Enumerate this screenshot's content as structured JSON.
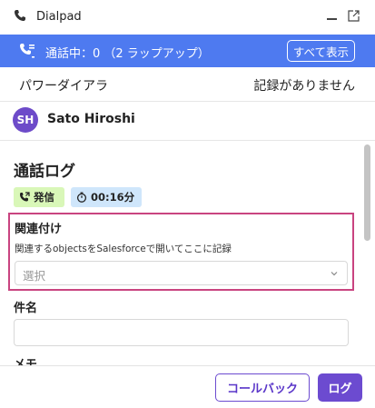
{
  "window": {
    "title": "Dialpad",
    "phone_icon": "phone-icon",
    "minimize_icon": "minimize-icon",
    "popout_icon": "popout-icon"
  },
  "banner": {
    "status_text": "通話中：0 （2 ラップアップ）",
    "show_all_label": "すべて表示",
    "icon": "call-queue-icon",
    "color": "#4e7af0"
  },
  "power_dialer": {
    "label": "パワーダイアラ",
    "status": "記録がありません"
  },
  "contact": {
    "initials": "SH",
    "name": "Sato Hiroshi",
    "avatar_color": "#6d4bc9"
  },
  "call_log": {
    "title": "通話ログ",
    "direction_badge": "発信",
    "duration_badge": "00:16分",
    "association": {
      "heading": "関連付け",
      "description": "関連するobjectsをSalesforceで開いてここに記録",
      "select_placeholder": "選択"
    },
    "subject_label": "件名",
    "subject_value": "",
    "memo_label": "メモ"
  },
  "footer": {
    "callback_label": "コールバック",
    "log_label": "ログ",
    "accent_color": "#6c4bd0"
  }
}
